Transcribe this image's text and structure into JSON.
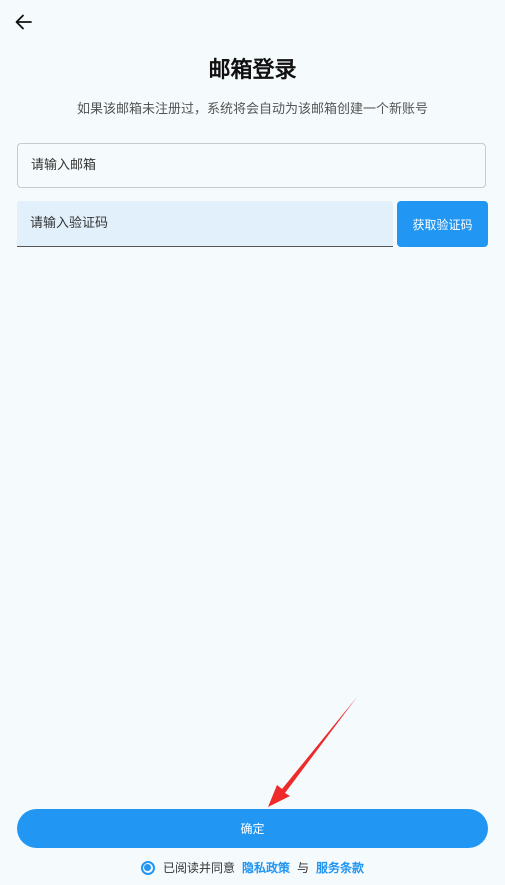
{
  "header": {
    "back_icon": "arrow-left-icon",
    "title": "邮箱登录",
    "subtitle": "如果该邮箱未注册过，系统将会自动为该邮箱创建一个新账号"
  },
  "form": {
    "email_placeholder": "请输入邮箱",
    "email_value": "",
    "code_placeholder": "请输入验证码",
    "code_value": "",
    "get_code_label": "获取验证码"
  },
  "footer": {
    "confirm_label": "确定",
    "agreement_checked": true,
    "agreement_prefix": "已阅读并同意",
    "privacy_link": "隐私政策",
    "conjunction": "与",
    "terms_link": "服务条款"
  },
  "colors": {
    "accent": "#2196f3",
    "background": "#f5fafd",
    "input_fill": "#e2f0fb",
    "annotation_arrow": "#ee2a2a"
  }
}
